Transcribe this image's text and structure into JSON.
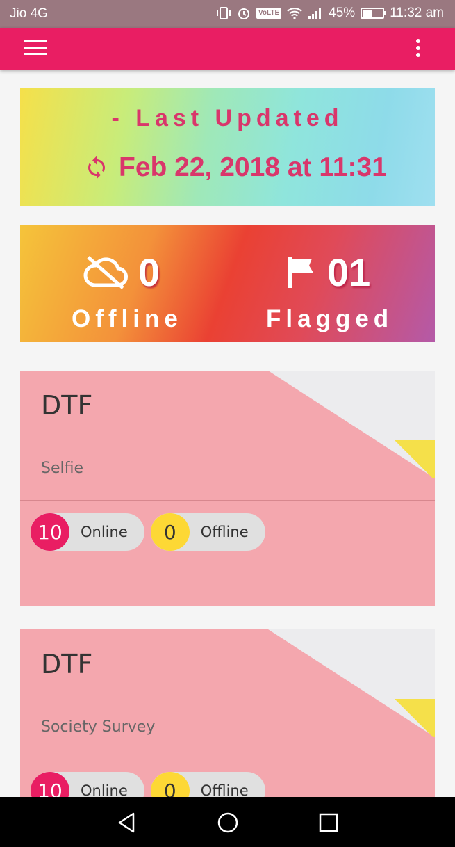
{
  "status_bar": {
    "carrier": "Jio 4G",
    "volte": "VoLTE",
    "battery_pct": "45%",
    "battery_level": 0.45,
    "time": "11:32 am"
  },
  "app_bar": {
    "menu_icon": "hamburger-menu-icon",
    "overflow_icon": "more-vert-icon"
  },
  "last_updated": {
    "title": "- Last Updated",
    "date": "Feb 22, 2018 at 11:31",
    "icon": "sync-icon"
  },
  "stats": {
    "offline": {
      "count": "0",
      "label": "Offline",
      "icon": "cloud-off-icon"
    },
    "flagged": {
      "count": "01",
      "label": "Flagged",
      "icon": "flag-icon"
    }
  },
  "surveys": [
    {
      "name": "DTF",
      "subtitle": "Selfie",
      "online_count": "10",
      "online_label": "Online",
      "offline_count": "0",
      "offline_label": "Offline"
    },
    {
      "name": "DTF",
      "subtitle": "Society Survey",
      "online_count": "10",
      "online_label": "Online",
      "offline_count": "0",
      "offline_label": "Offline"
    }
  ],
  "colors": {
    "primary": "#e91e63",
    "accent_text": "#d9366b",
    "card_pink": "#f4a7ae",
    "offline_badge": "#fdd835"
  }
}
